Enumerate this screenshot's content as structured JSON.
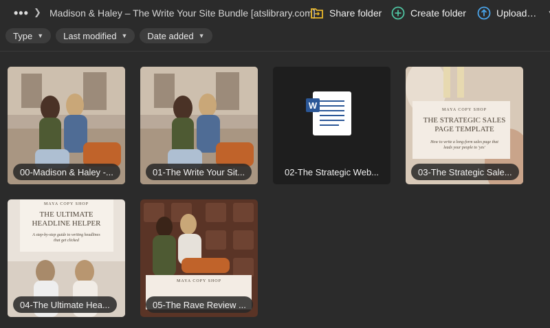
{
  "header": {
    "more": "•••",
    "folder_title": "Madison & Haley – The Write Your Site Bundle [atslibrary.com]",
    "share_label": "Share folder",
    "create_label": "Create folder",
    "upload_label": "Upload…"
  },
  "filters": [
    {
      "label": "Type"
    },
    {
      "label": "Last modified"
    },
    {
      "label": "Date added"
    }
  ],
  "items": [
    {
      "label": "00-Madison & Haley -...",
      "kind": "photo"
    },
    {
      "label": "01-The Write Your Sit...",
      "kind": "photo"
    },
    {
      "label": "02-The Strategic Web...",
      "kind": "word-doc"
    },
    {
      "label": "03-The Strategic Sale...",
      "kind": "cover",
      "cover_brand": "MAYA COPY SHOP",
      "cover_title": "THE STRATEGIC SALES PAGE TEMPLATE",
      "cover_sub": "How to write a long-form sales page that leads your people to 'yes'"
    },
    {
      "label": "04-The Ultimate Hea...",
      "kind": "cover",
      "cover_brand": "MAYA COPY SHOP",
      "cover_title": "THE ULTIMATE HEADLINE HELPER",
      "cover_sub": "A step-by-step guide to writing headlines that get clicked"
    },
    {
      "label": "05-The Rave Review ...",
      "kind": "photo",
      "cover_brand": "MAYA COPY SHOP"
    }
  ],
  "colors": {
    "background": "#2b2b2b",
    "share_icon": "#e9b72a",
    "create_icon": "#4fc3a1",
    "upload_icon": "#4aa3e8"
  }
}
